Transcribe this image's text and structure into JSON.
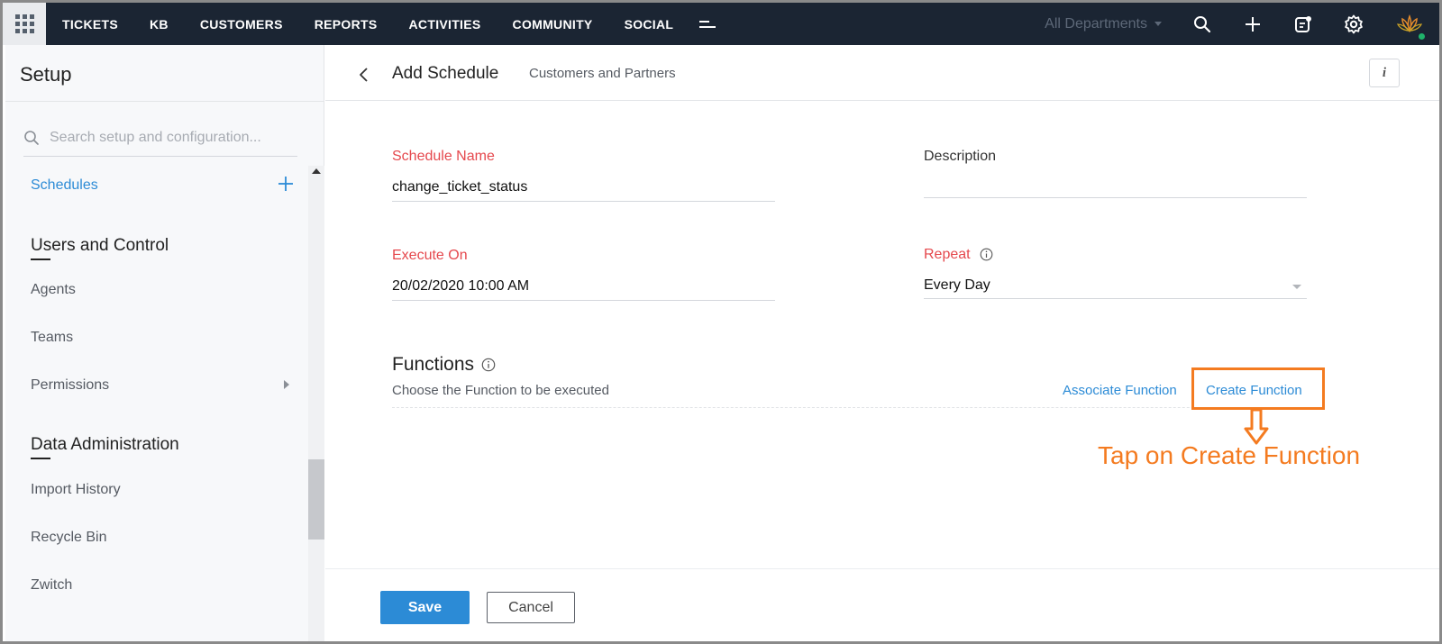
{
  "topnav": {
    "items": [
      "TICKETS",
      "KB",
      "CUSTOMERS",
      "REPORTS",
      "ACTIVITIES",
      "COMMUNITY",
      "SOCIAL"
    ],
    "department": "All Departments",
    "icons": [
      "apps-grid-icon",
      "more-menu-icon",
      "search-icon",
      "plus-icon",
      "compose-icon",
      "gear-icon",
      "avatar"
    ],
    "colors": {
      "bg": "#1b2533",
      "online": "#1fb36b"
    }
  },
  "sidebar": {
    "title": "Setup",
    "search_placeholder": "Search setup and configuration...",
    "active_item": "Schedules",
    "sections": [
      {
        "title": "Users and Control",
        "items": [
          "Agents",
          "Teams",
          "Permissions"
        ]
      },
      {
        "title": "Data Administration",
        "items": [
          "Import History",
          "Recycle Bin",
          "Zwitch"
        ]
      }
    ]
  },
  "header": {
    "title": "Add Schedule",
    "subtitle": "Customers and Partners",
    "info": "i"
  },
  "form": {
    "schedule_name_label": "Schedule Name",
    "schedule_name_value": "change_ticket_status",
    "description_label": "Description",
    "description_value": "",
    "execute_on_label": "Execute On",
    "execute_on_value": "20/02/2020 10:00 AM",
    "repeat_label": "Repeat",
    "repeat_value": "Every Day"
  },
  "functions": {
    "title": "Functions",
    "description": "Choose the Function to be executed",
    "associate_label": "Associate Function",
    "create_label": "Create Function"
  },
  "annotation": {
    "text": "Tap on Create Function",
    "color": "#f47b20"
  },
  "footer": {
    "save_label": "Save",
    "cancel_label": "Cancel",
    "accent": "#2c8bd6"
  }
}
